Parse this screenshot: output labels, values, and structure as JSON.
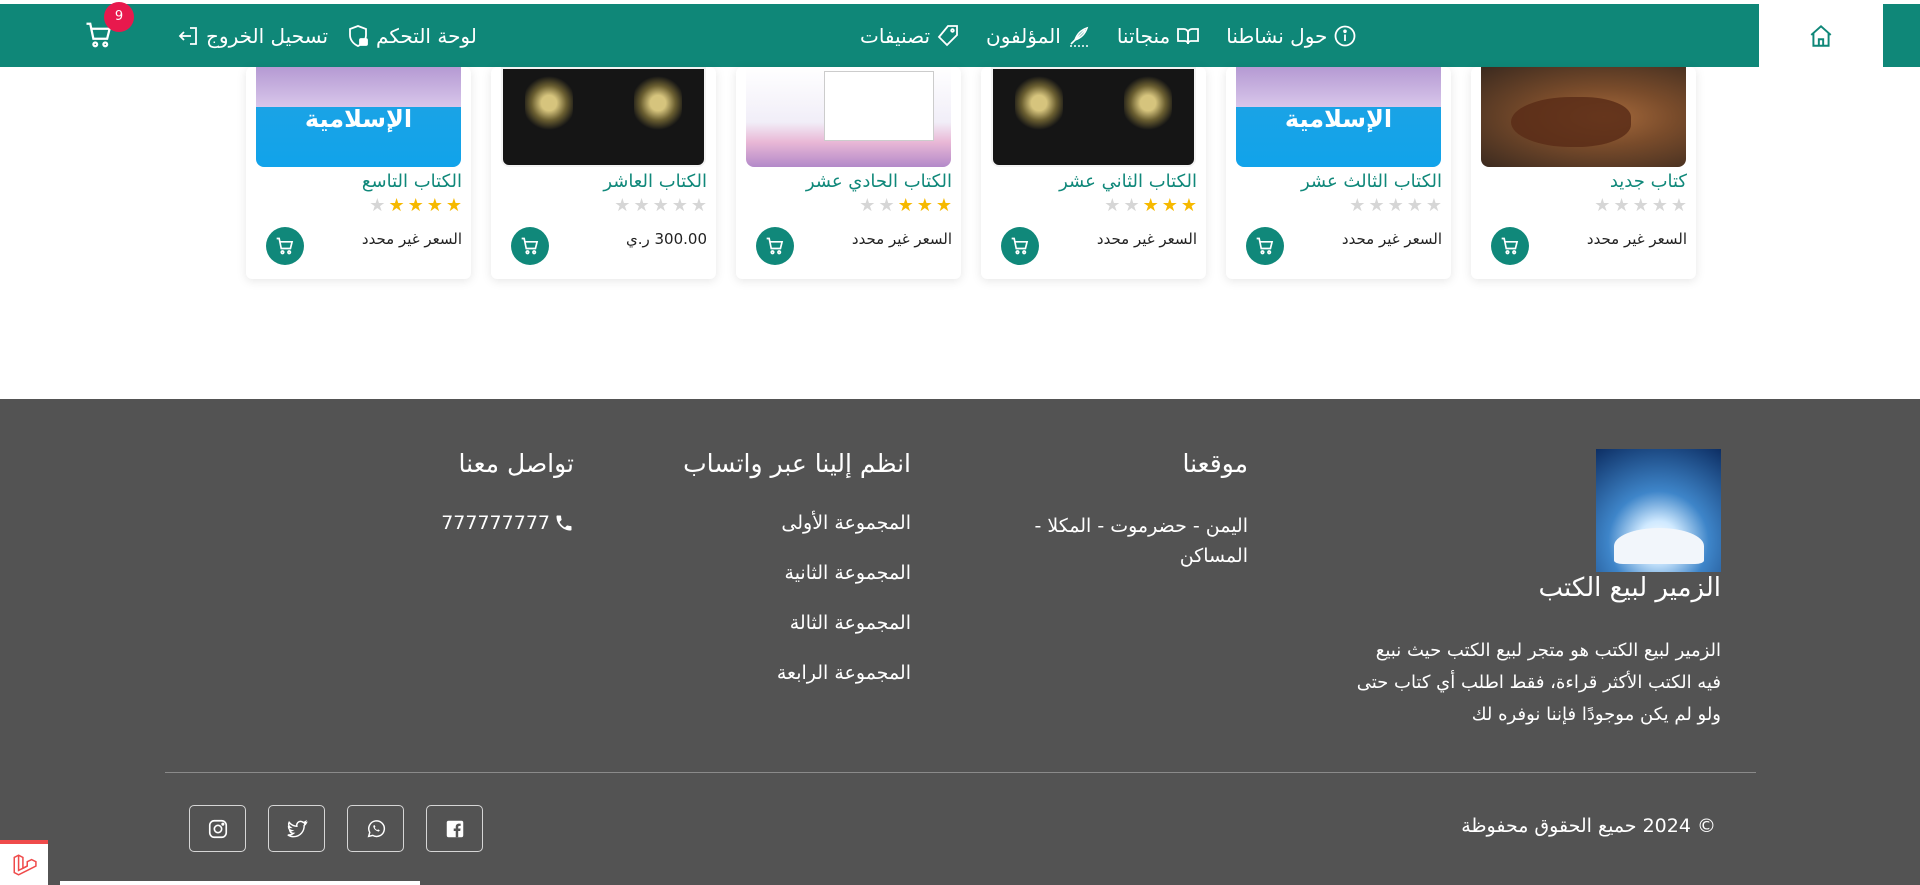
{
  "colors": {
    "primary": "#0f8778",
    "footer_bg": "#535353",
    "badge": "#e8194d",
    "star_on": "#f6b900",
    "star_off": "#d6d6d6"
  },
  "nav": {
    "home_icon": "home-icon",
    "links": [
      {
        "label": "حول نشاطنا",
        "icon": "info-icon"
      },
      {
        "label": "منجاتنا",
        "icon": "open-book-icon"
      },
      {
        "label": "المؤلفون",
        "icon": "feather-icon"
      },
      {
        "label": "تصنيفات",
        "icon": "tag-icon"
      }
    ],
    "dashboard": "لوحة التحكم",
    "logout": "تسحيل الخروج",
    "cart_count": "9"
  },
  "products": [
    {
      "title": "كتاب جديد",
      "rating": 0,
      "price": "السعر غير محدد",
      "cover": "cave"
    },
    {
      "title": "الكتاب الثالث عشر",
      "rating": 0,
      "price": "السعر غير محدد",
      "cover": "blue",
      "cover_text": "الإسلامية"
    },
    {
      "title": "الكتاب الثاني عشر",
      "rating": 3,
      "price": "السعر غير محدد",
      "cover": "black"
    },
    {
      "title": "الكتاب الحادي عشر",
      "rating": 3,
      "price": "السعر غير محدد",
      "cover": "mosque"
    },
    {
      "title": "الكتاب العاشر",
      "rating": 0,
      "price": "300.00 ر.ي",
      "cover": "black"
    },
    {
      "title": "الكتاب التاسع",
      "rating": 4,
      "price": "السعر غير محدد",
      "cover": "blue",
      "cover_text": "الإسلامية"
    }
  ],
  "footer": {
    "brand_name": "الزمير لبيع الكتب",
    "about": "الزمير لبيع الكتب هو متجر لبيع الكتب حيث نبيع فيه الكتب الأكثر قراءة، فقط اطلب أي كتاب حتى ولو لم يكن موجودًا فإننا نوفره لك",
    "location_title": "موقعنا",
    "location_text": "اليمن - حضرموت - المكلا - المساكن",
    "whatsapp_title": "انظم إلينا عبر واتساب",
    "whatsapp_groups": [
      "المجموعة الأولى",
      "المجموعة الثانية",
      "المجموعة الثالة",
      "المجموعة الرابعة"
    ],
    "contact_title": "تواصل معنا",
    "phone": "777777777",
    "copyright": "© 2024 حميع الحقوق محفوظة",
    "socials": [
      "facebook-icon",
      "whatsapp-icon",
      "twitter-icon",
      "instagram-icon"
    ]
  }
}
